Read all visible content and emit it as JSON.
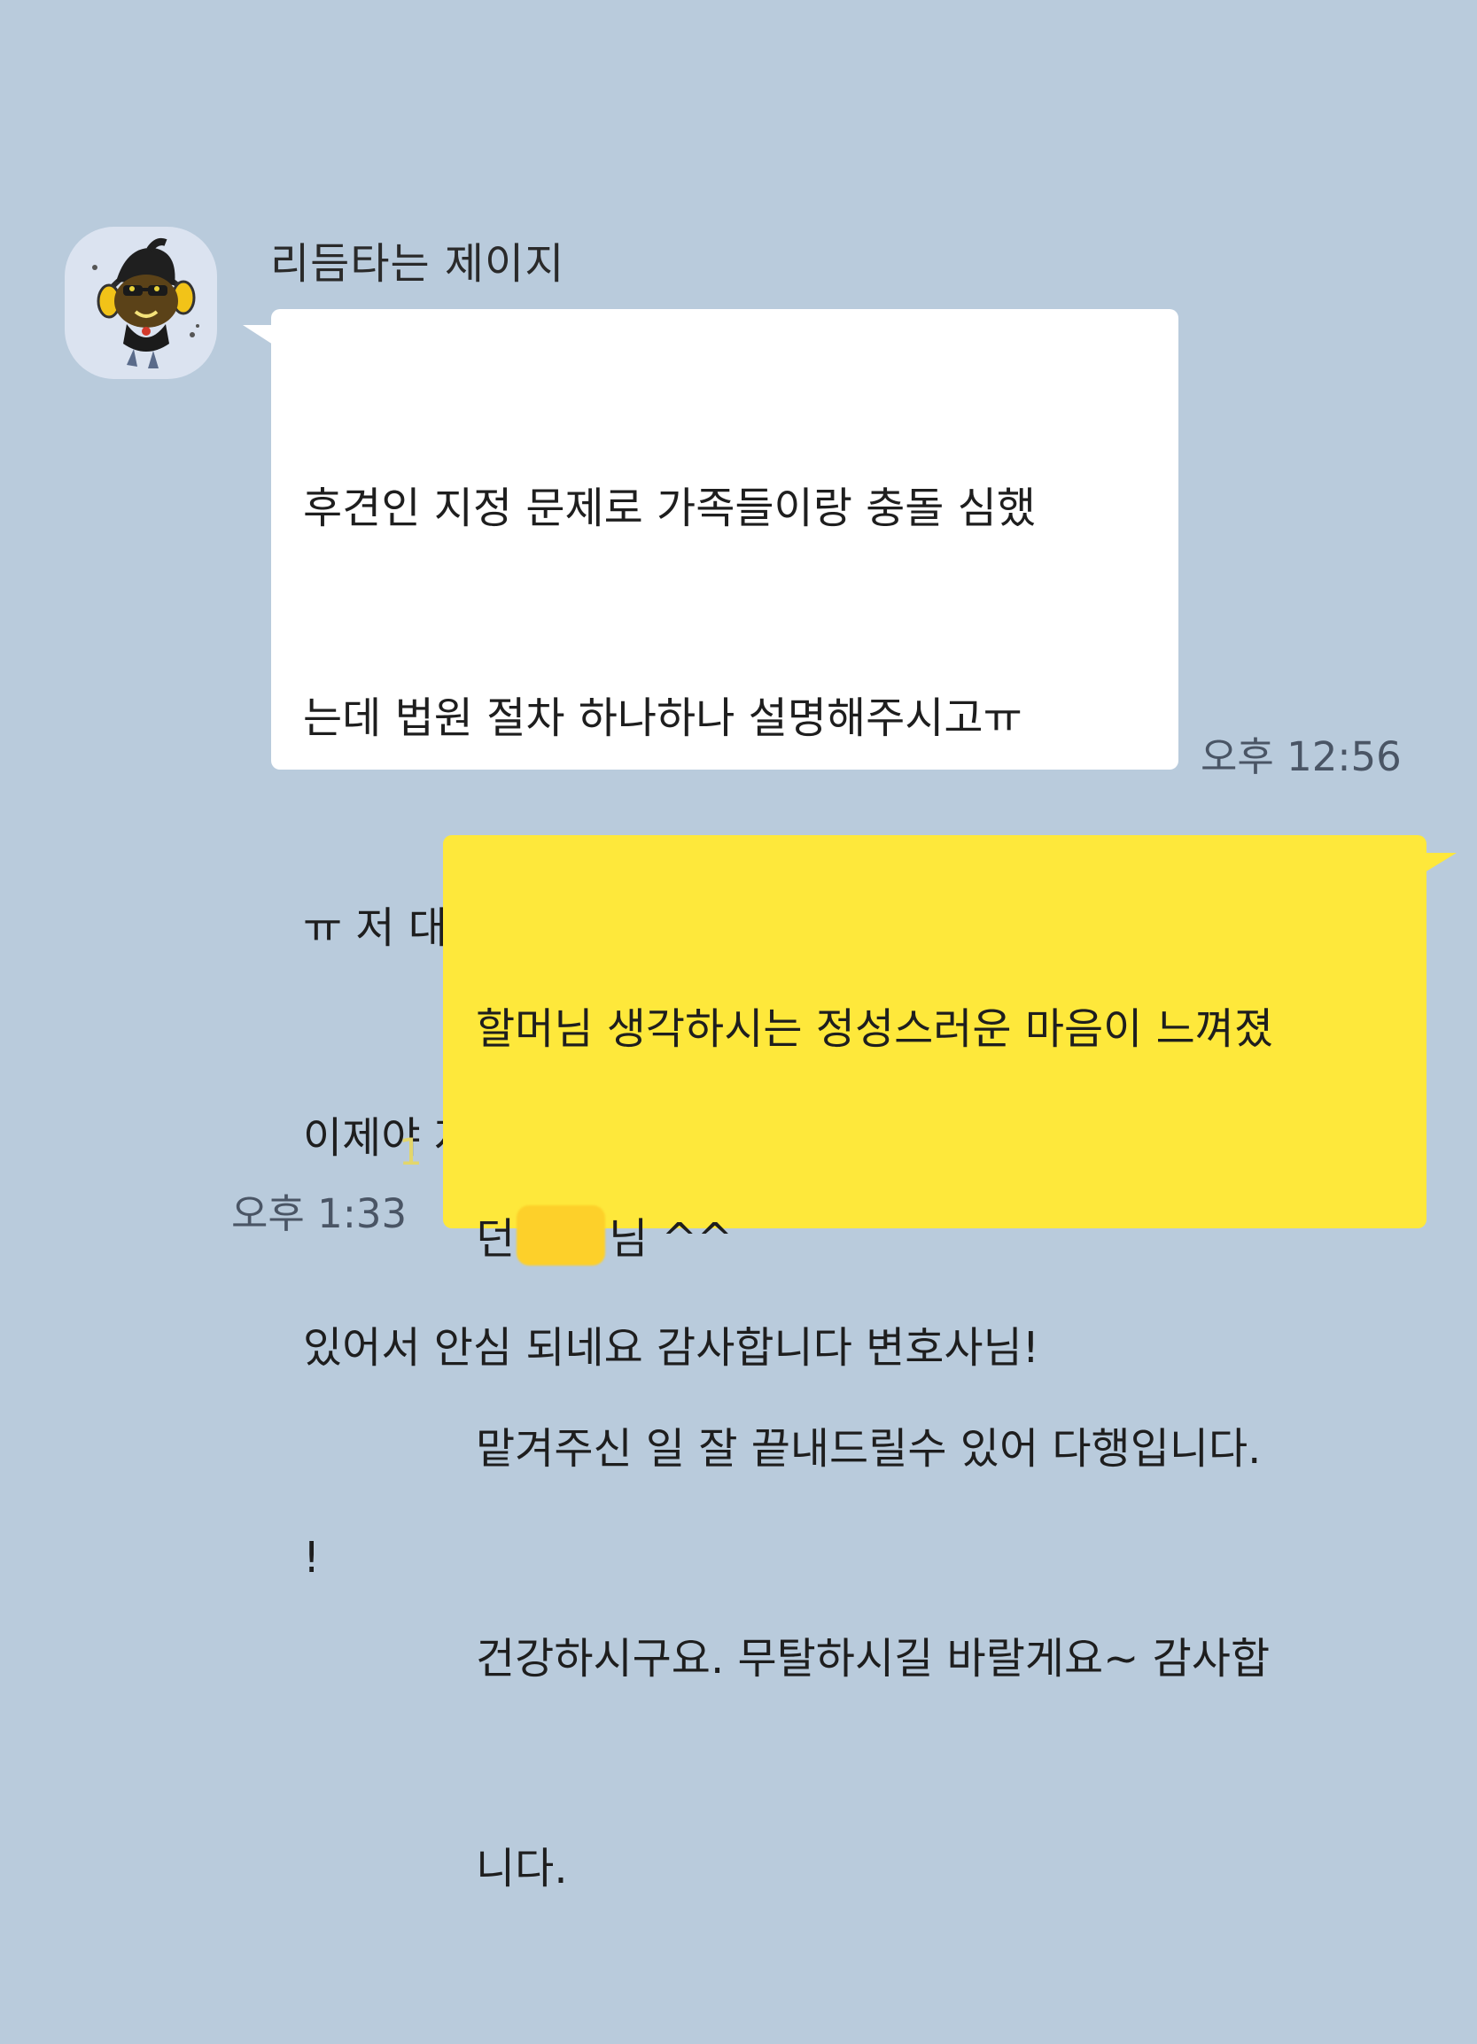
{
  "chat": {
    "incoming": {
      "sender_name": "리듬타는 제이지",
      "avatar_icon": "jay-g-character-avatar",
      "message_lines": [
        "후견인 지정 문제로 가족들이랑 충돌 심했",
        "는데 법원 절차 하나하나 설명해주시고ㅠ",
        "ㅠ 저 대신 말씀해주신 거 너무 감사했어요",
        "이제야 저희 할머니 제가 떳떳하게 챙길 수",
        "있어서 안심 되네요 감사합니다 변호사님!",
        "!"
      ],
      "time": "오후 12:56"
    },
    "outgoing": {
      "line1": "할머님 생각하시는 정성스러운 마음이 느껴졌",
      "line2_prefix": "던",
      "line2_suffix": "님 ^^",
      "line3": "맡겨주신 일 잘 끝내드릴수 있어 다행입니다.",
      "line4": "건강하시구요. 무탈하시길 바랄게요~ 감사합",
      "line5": "니다.",
      "read_count": "1",
      "time": "오후 1:33"
    }
  },
  "colors": {
    "background": "#b9cbdc",
    "incoming_bubble": "#ffffff",
    "outgoing_bubble": "#fee83b",
    "redaction": "#fdd02a"
  }
}
